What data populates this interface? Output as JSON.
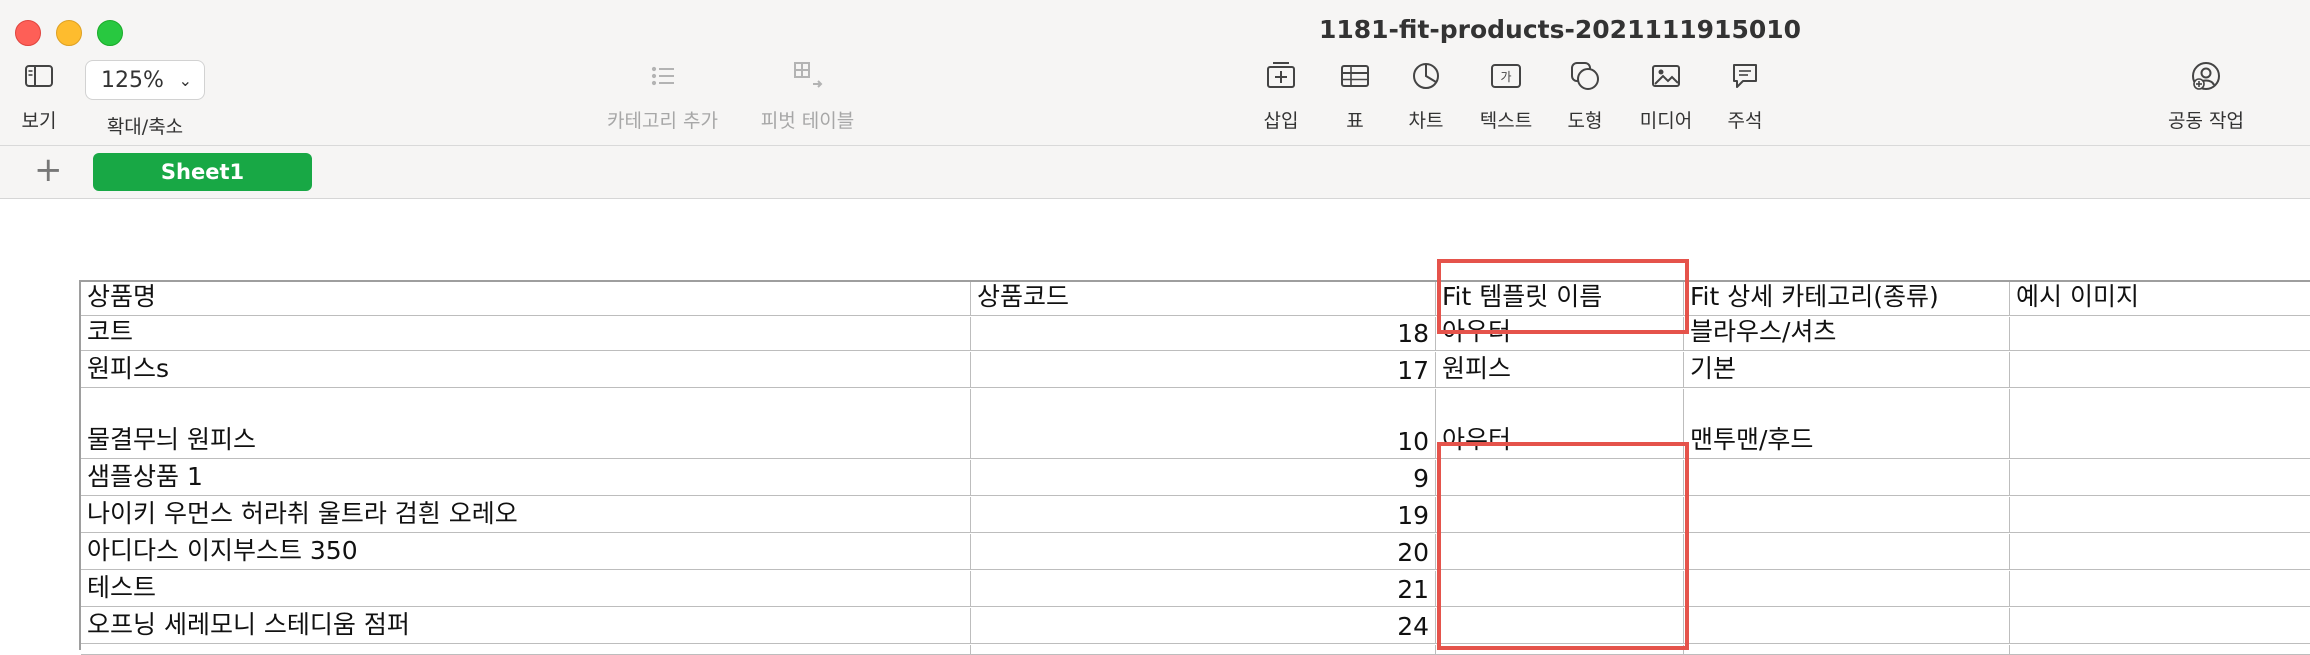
{
  "window": {
    "title": "1181-fit-products-2021111915010"
  },
  "toolbar": {
    "view_label": "보기",
    "zoom_value": "125%",
    "zoom_label": "확대/축소",
    "add_category_label": "카테고리 추가",
    "pivot_table_label": "피벗 테이블",
    "insert_label": "삽입",
    "table_label": "표",
    "chart_label": "차트",
    "text_label": "텍스트",
    "text_icon_glyph": "가",
    "shape_label": "도형",
    "media_label": "미디어",
    "comment_label": "주석",
    "collaborate_label": "공동 작업"
  },
  "sheets": {
    "add_icon": "+",
    "active": "Sheet1"
  },
  "table": {
    "headers": [
      "상품명",
      "상품코드",
      "Fit 템플릿 이름",
      "Fit 상세 카테고리(종류)",
      "예시 이미지"
    ],
    "rows": [
      [
        "코트",
        "18",
        "아우터",
        "블라우스/셔츠",
        ""
      ],
      [
        "원피스s",
        "17",
        "원피스",
        "기본",
        ""
      ],
      [
        "물결무늬 원피스",
        "10",
        "아우터",
        "맨투맨/후드",
        ""
      ],
      [
        "샘플상품 1",
        "9",
        "",
        "",
        ""
      ],
      [
        "나이키 우먼스 허라취 울트라 검흰 오레오",
        "19",
        "",
        "",
        ""
      ],
      [
        "아디다스 이지부스트 350",
        "20",
        "",
        "",
        ""
      ],
      [
        "테스트",
        "21",
        "",
        "",
        ""
      ],
      [
        "오프닝 세레모니 스테디움 점퍼",
        "24",
        "",
        "",
        ""
      ]
    ]
  },
  "icons": {
    "view": "sidebar-icon",
    "add_category": "list-icon",
    "pivot": "pivot-table-icon",
    "insert": "insert-icon",
    "table": "table-icon",
    "chart": "chart-icon",
    "text": "text-box-icon",
    "shape": "shape-icon",
    "media": "media-icon",
    "comment": "comment-icon",
    "collaborate": "collaborate-icon"
  },
  "colors": {
    "accent": "#18a845",
    "highlight": "#e5534b"
  }
}
